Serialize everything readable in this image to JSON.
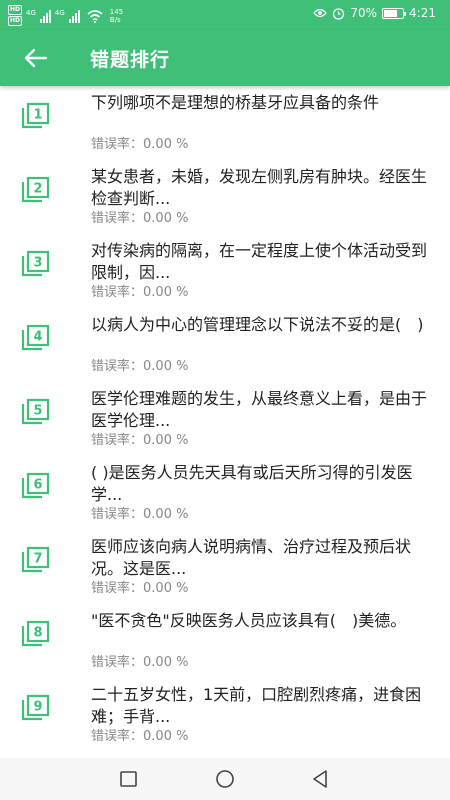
{
  "status_bar": {
    "hd1": "HD",
    "hd2": "HD",
    "net1": "4G",
    "net2": "4G",
    "speed": "145",
    "speed_unit": "B/s",
    "battery": "70%",
    "battery_level": 0.7,
    "time": "4:21"
  },
  "app_bar": {
    "title": "错题排行"
  },
  "theme": {
    "primary": "#3fbf77",
    "icon": "#3fbf77"
  },
  "rate_label": "错误率：",
  "items": [
    {
      "num": "1",
      "question": "下列哪项不是理想的桥基牙应具备的条件",
      "rate": "0.00 %"
    },
    {
      "num": "2",
      "question": "某女患者，未婚，发现左侧乳房有肿块。经医生检查判断...",
      "rate": "0.00 %"
    },
    {
      "num": "3",
      "question": "对传染病的隔离，在一定程度上使个体活动受到限制，因...",
      "rate": "0.00 %"
    },
    {
      "num": "4",
      "question": "以病人为中心的管理理念以下说法不妥的是(　)",
      "rate": "0.00 %"
    },
    {
      "num": "5",
      "question": "医学伦理难题的发生，从最终意义上看，是由于医学伦理...",
      "rate": "0.00 %"
    },
    {
      "num": "6",
      "question": "(   )是医务人员先天具有或后天所习得的引发医学...",
      "rate": "0.00 %"
    },
    {
      "num": "7",
      "question": "医师应该向病人说明病情、治疗过程及预后状况。这是医...",
      "rate": "0.00 %"
    },
    {
      "num": "8",
      "question": "\"医不贪色\"反映医务人员应该具有(　)美德。",
      "rate": "0.00 %"
    },
    {
      "num": "9",
      "question": "二十五岁女性，1天前，口腔剧烈疼痛，进食困难；手背...",
      "rate": "0.00 %"
    }
  ]
}
